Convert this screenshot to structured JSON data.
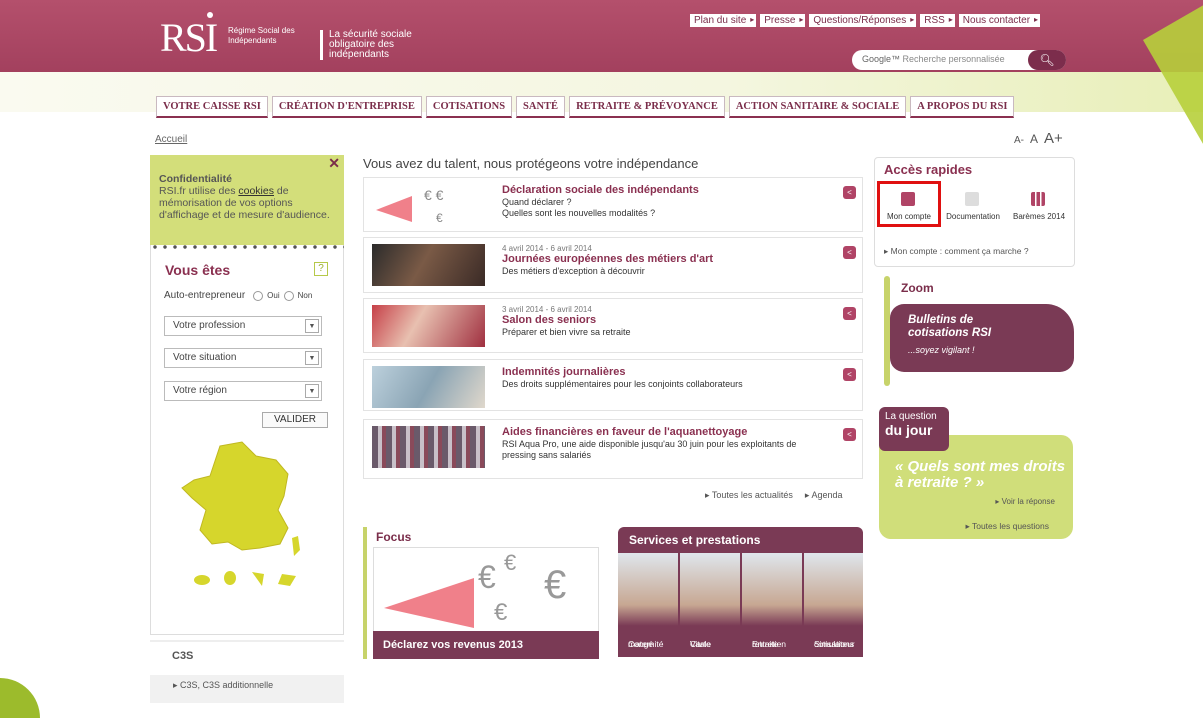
{
  "header": {
    "logo_text": "RSI",
    "logo_sub": "Régime Social des Indépendants",
    "tagline": "La sécurité sociale obligatoire des indépendants",
    "toplinks": [
      "Plan du site",
      "Presse",
      "Questions/Réponses",
      "RSS",
      "Nous contacter"
    ],
    "search_placeholder": "Recherche personnalisée",
    "search_brand": "Google™"
  },
  "nav": [
    "VOTRE CAISSE RSI",
    "CRÉATION D'ENTREPRISE",
    "COTISATIONS",
    "SANTÉ",
    "RETRAITE & PRÉVOYANCE",
    "ACTION SANITAIRE & SOCIALE",
    "A PROPOS DU RSI"
  ],
  "breadcrumb": "Accueil",
  "fontsizes": [
    "A-",
    "A",
    "A+"
  ],
  "cookie": {
    "title": "Confidentialité",
    "text1": "RSI.fr utilise des ",
    "link": "cookies",
    "text2": " de mémorisation de vos options d'affichage et de mesure d'audience."
  },
  "vous_etes": {
    "title": "Vous êtes",
    "auto": "Auto-entrepreneur",
    "oui": "Oui",
    "non": "Non",
    "selects": [
      "Votre profession",
      "Votre situation",
      "Votre région"
    ],
    "valider": "VALIDER"
  },
  "c3s": {
    "title": "C3S",
    "link": "C3S, C3S additionnelle"
  },
  "main_title": "Vous avez du talent, nous protégeons votre indépendance",
  "news": [
    {
      "date": "",
      "title": "Déclaration sociale des indépendants",
      "desc": "Quand déclarer ?",
      "desc2": "Quelles sont les nouvelles modalités ?"
    },
    {
      "date": "4 avril 2014 - 6 avril 2014",
      "title": "Journées européennes des métiers d'art",
      "desc": "Des métiers d'exception à découvrir",
      "desc2": ""
    },
    {
      "date": "3 avril 2014 - 6 avril 2014",
      "title": "Salon des seniors",
      "desc": "Préparer et bien vivre sa retraite",
      "desc2": ""
    },
    {
      "date": "",
      "title": "Indemnités journalières",
      "desc": "Des droits supplémentaires pour les conjoints collaborateurs",
      "desc2": ""
    },
    {
      "date": "",
      "title": "Aides financières en faveur de l'aquanettoyage",
      "desc": "RSI Aqua Pro, une aide disponible jusqu'au 30 juin pour les exploitants de pressing sans salariés",
      "desc2": ""
    }
  ],
  "more": {
    "all": "Toutes les actualités",
    "agenda": "Agenda"
  },
  "focus": {
    "title": "Focus",
    "caption": "Déclarez vos revenus 2013"
  },
  "services": {
    "title": "Services et prestations",
    "items": [
      [
        "Congé",
        "maternité"
      ],
      [
        "Carte",
        "Vitale"
      ],
      [
        "Entretien",
        "retraite"
      ],
      [
        "Simulateur",
        "cotisations"
      ]
    ]
  },
  "acces": {
    "title": "Accès rapides",
    "items": [
      "Mon compte",
      "Documentation",
      "Barèmes 2014"
    ],
    "link": "Mon compte : comment ça marche ?"
  },
  "zoom": {
    "title": "Zoom",
    "bold": "Bulletins de cotisations RSI",
    "italic": "...soyez vigilant !"
  },
  "question": {
    "small": "La question",
    "big": "du jour",
    "text": "« Quels sont mes droits à retraite ? »",
    "answer": "Voir la réponse",
    "all": "Toutes les questions"
  },
  "colors": {
    "brand": "#9e3c5a",
    "green": "#b7cf3b",
    "highlight": "#e01010"
  }
}
